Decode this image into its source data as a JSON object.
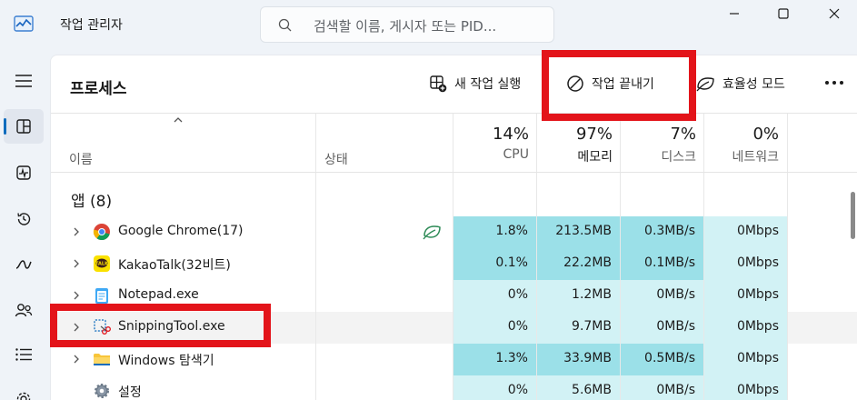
{
  "window": {
    "title": "작업 관리자",
    "search_placeholder": "검색할 이름, 게시자 또는 PID..."
  },
  "nav": {
    "items": [
      {
        "icon": "hamburger-menu-icon"
      },
      {
        "icon": "processes-icon",
        "active": true
      },
      {
        "icon": "performance-icon"
      },
      {
        "icon": "app-history-icon"
      },
      {
        "icon": "startup-apps-icon"
      },
      {
        "icon": "users-icon"
      },
      {
        "icon": "details-icon"
      },
      {
        "icon": "services-icon"
      }
    ]
  },
  "toolbar": {
    "page_title": "프로세스",
    "new_task": "새 작업 실행",
    "end_task": "작업 끝내기",
    "efficiency": "효율성 모드"
  },
  "columns": {
    "name": "이름",
    "status": "상태",
    "cpu": {
      "pct": "14%",
      "label": "CPU"
    },
    "memory": {
      "pct": "97%",
      "label": "메모리"
    },
    "disk": {
      "pct": "7%",
      "label": "디스크"
    },
    "network": {
      "pct": "0%",
      "label": "네트워크"
    }
  },
  "group": {
    "title": "앱 (8)"
  },
  "processes": [
    {
      "name": "Google Chrome(17)",
      "icon": "chrome-icon",
      "efficiency": true,
      "cpu": "1.8%",
      "memory": "213.5MB",
      "disk": "0.3MB/s",
      "network": "0Mbps"
    },
    {
      "name": "KakaoTalk(32비트)",
      "icon": "kakaotalk-icon",
      "efficiency": false,
      "cpu": "0.1%",
      "memory": "22.2MB",
      "disk": "0.1MB/s",
      "network": "0Mbps"
    },
    {
      "name": "Notepad.exe",
      "icon": "notepad-icon",
      "efficiency": false,
      "cpu": "0%",
      "memory": "1.2MB",
      "disk": "0MB/s",
      "network": "0Mbps"
    },
    {
      "name": "SnippingTool.exe",
      "icon": "snipping-tool-icon",
      "efficiency": false,
      "cpu": "0%",
      "memory": "9.7MB",
      "disk": "0MB/s",
      "network": "0Mbps",
      "selected": true
    },
    {
      "name": "Windows 탐색기",
      "icon": "file-explorer-icon",
      "efficiency": false,
      "cpu": "1.3%",
      "memory": "33.9MB",
      "disk": "0.5MB/s",
      "network": "0Mbps"
    },
    {
      "name": "설정",
      "icon": "settings-gear-icon",
      "efficiency": false,
      "cpu": "0%",
      "memory": "5.6MB",
      "disk": "0MB/s",
      "network": "0Mbps"
    }
  ],
  "colors": {
    "heat_strong": "#9be0e8",
    "heat_light": "#d2f2f5",
    "annotation": "#e3141a",
    "accent": "#0f6cbd"
  }
}
